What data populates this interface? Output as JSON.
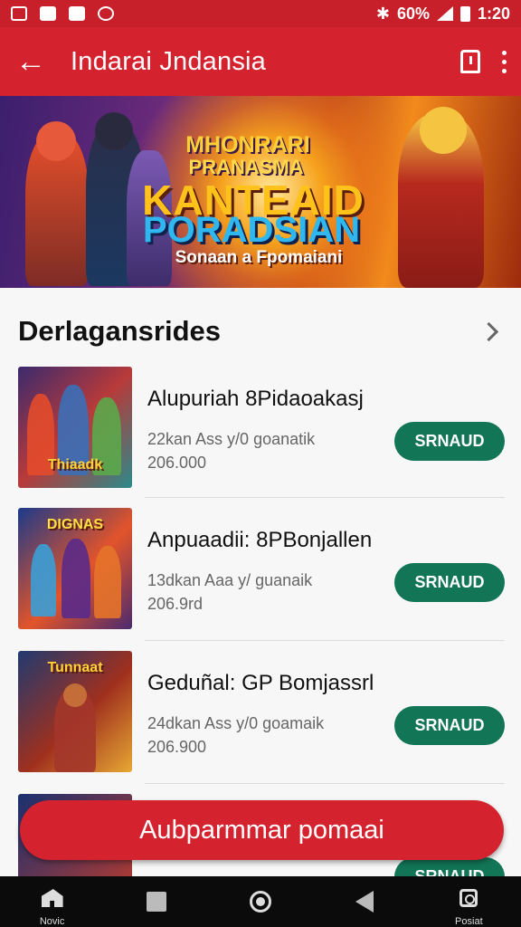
{
  "status_bar": {
    "battery_text": "60%",
    "time": "1:20"
  },
  "app_bar": {
    "title": "Indarai Jndansia"
  },
  "banner": {
    "line1": "MHONRARI",
    "line2": "PRANASMA",
    "line3": "KANTEAID",
    "line4": "PORADSIAN",
    "line5": "Sonaan a Fpomaiani"
  },
  "section": {
    "title": "Derlagansrides"
  },
  "items": [
    {
      "name": "Alupuriah 8Pidaoakasj",
      "meta1": "22kan Ass y/0 goanatik",
      "meta2": "206.000",
      "button": "SRNAUD",
      "thumb_title": "Thiaadk"
    },
    {
      "name": "Anpuaadii: 8PBonjallen",
      "meta1": "13dkan Aaa y/ guanaik",
      "meta2": "206.9rd",
      "button": "SRNAUD",
      "thumb_title": "DIGNAS"
    },
    {
      "name": "Geduñal: GP Bomjassrl",
      "meta1": "24dkan Ass y/0 goamaik",
      "meta2": "206.900",
      "button": "SRNAUD",
      "thumb_title": "Tunnaat"
    },
    {
      "name": "",
      "meta1": "",
      "meta2": "",
      "button": "SRNAUD",
      "thumb_title": ""
    }
  ],
  "cta": {
    "label": "Aubparmmar pomaai"
  },
  "nav": {
    "left_label": "Novic",
    "right_label": "Posiat"
  },
  "colors": {
    "primary_red": "#d4232f",
    "button_green": "#127556"
  }
}
